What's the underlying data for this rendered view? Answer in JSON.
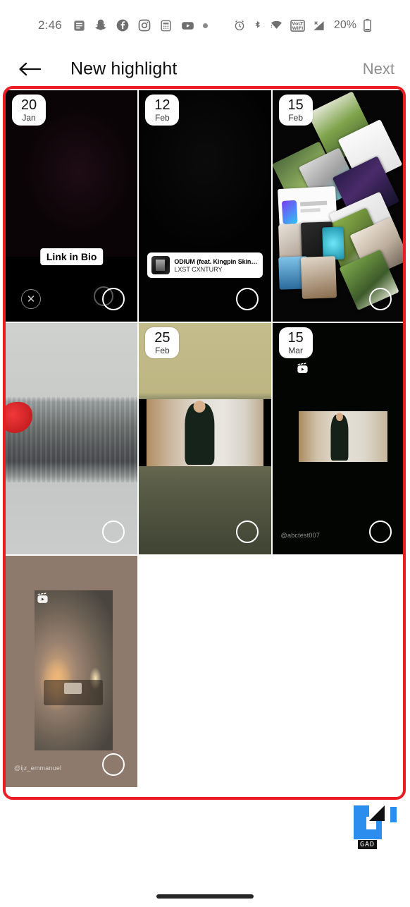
{
  "status_bar": {
    "time": "2:46",
    "battery_percent": "20%",
    "left_icons": [
      "messages-icon",
      "snapchat-icon",
      "facebook-icon",
      "instagram-icon",
      "calculator-icon",
      "youtube-icon",
      "more-dot-icon"
    ],
    "right_icons": [
      "alarm-icon",
      "bluetooth-icon",
      "wifi-icon",
      "volte-wifi-icon",
      "signal-icon",
      "battery-icon"
    ]
  },
  "header": {
    "back_label": "←",
    "title": "New highlight",
    "next_label": "Next"
  },
  "annotation": {
    "highlight_color": "#ec1c24",
    "shape": "rounded-rectangle"
  },
  "watermark": {
    "label": "GAD",
    "blue": "#2b8ded",
    "black": "#111111"
  },
  "grid": {
    "stories": [
      {
        "id": "story-1",
        "day": "20",
        "month": "Jan",
        "media": "dark-purple",
        "selected": true,
        "has_close": true,
        "sticker_type": "link",
        "sticker_text": "Link in Bio"
      },
      {
        "id": "story-2",
        "day": "12",
        "month": "Feb",
        "media": "black",
        "selected": false,
        "has_close": false,
        "sticker_type": "music",
        "music_title": "ODIUM (feat. Kingpin Skinny Pimp)",
        "music_artist": "LXST CXNTURY"
      },
      {
        "id": "story-3",
        "day": "15",
        "month": "Feb",
        "media": "collage",
        "selected": false,
        "has_close": false,
        "sticker_type": "none"
      },
      {
        "id": "story-4",
        "day": "",
        "month": "",
        "media": "metal",
        "selected": false,
        "has_close": false,
        "sticker_type": "none"
      },
      {
        "id": "story-5",
        "day": "25",
        "month": "Feb",
        "media": "olive",
        "selected": false,
        "has_close": false,
        "sticker_type": "none"
      },
      {
        "id": "story-6",
        "day": "15",
        "month": "Mar",
        "media": "dark-reel",
        "selected": false,
        "has_close": false,
        "sticker_type": "handle",
        "handle": "@abctest007",
        "has_reels_icon": true
      },
      {
        "id": "story-7",
        "day": "",
        "month": "",
        "media": "brown-night",
        "selected": false,
        "has_close": false,
        "sticker_type": "handle",
        "handle": "@ijz_emmanuel",
        "has_reels_icon": true
      }
    ]
  }
}
